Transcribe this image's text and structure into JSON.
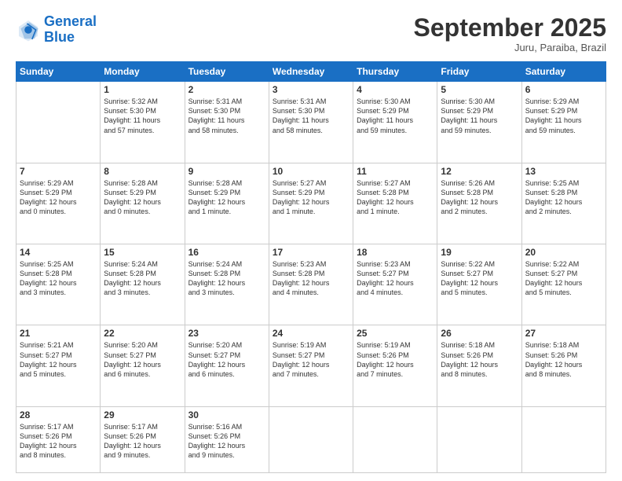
{
  "logo": {
    "line1": "General",
    "line2": "Blue"
  },
  "title": "September 2025",
  "subtitle": "Juru, Paraiba, Brazil",
  "weekdays": [
    "Sunday",
    "Monday",
    "Tuesday",
    "Wednesday",
    "Thursday",
    "Friday",
    "Saturday"
  ],
  "weeks": [
    [
      {
        "day": "",
        "info": ""
      },
      {
        "day": "1",
        "info": "Sunrise: 5:32 AM\nSunset: 5:30 PM\nDaylight: 11 hours\nand 57 minutes."
      },
      {
        "day": "2",
        "info": "Sunrise: 5:31 AM\nSunset: 5:30 PM\nDaylight: 11 hours\nand 58 minutes."
      },
      {
        "day": "3",
        "info": "Sunrise: 5:31 AM\nSunset: 5:30 PM\nDaylight: 11 hours\nand 58 minutes."
      },
      {
        "day": "4",
        "info": "Sunrise: 5:30 AM\nSunset: 5:29 PM\nDaylight: 11 hours\nand 59 minutes."
      },
      {
        "day": "5",
        "info": "Sunrise: 5:30 AM\nSunset: 5:29 PM\nDaylight: 11 hours\nand 59 minutes."
      },
      {
        "day": "6",
        "info": "Sunrise: 5:29 AM\nSunset: 5:29 PM\nDaylight: 11 hours\nand 59 minutes."
      }
    ],
    [
      {
        "day": "7",
        "info": "Sunrise: 5:29 AM\nSunset: 5:29 PM\nDaylight: 12 hours\nand 0 minutes."
      },
      {
        "day": "8",
        "info": "Sunrise: 5:28 AM\nSunset: 5:29 PM\nDaylight: 12 hours\nand 0 minutes."
      },
      {
        "day": "9",
        "info": "Sunrise: 5:28 AM\nSunset: 5:29 PM\nDaylight: 12 hours\nand 1 minute."
      },
      {
        "day": "10",
        "info": "Sunrise: 5:27 AM\nSunset: 5:29 PM\nDaylight: 12 hours\nand 1 minute."
      },
      {
        "day": "11",
        "info": "Sunrise: 5:27 AM\nSunset: 5:28 PM\nDaylight: 12 hours\nand 1 minute."
      },
      {
        "day": "12",
        "info": "Sunrise: 5:26 AM\nSunset: 5:28 PM\nDaylight: 12 hours\nand 2 minutes."
      },
      {
        "day": "13",
        "info": "Sunrise: 5:25 AM\nSunset: 5:28 PM\nDaylight: 12 hours\nand 2 minutes."
      }
    ],
    [
      {
        "day": "14",
        "info": "Sunrise: 5:25 AM\nSunset: 5:28 PM\nDaylight: 12 hours\nand 3 minutes."
      },
      {
        "day": "15",
        "info": "Sunrise: 5:24 AM\nSunset: 5:28 PM\nDaylight: 12 hours\nand 3 minutes."
      },
      {
        "day": "16",
        "info": "Sunrise: 5:24 AM\nSunset: 5:28 PM\nDaylight: 12 hours\nand 3 minutes."
      },
      {
        "day": "17",
        "info": "Sunrise: 5:23 AM\nSunset: 5:28 PM\nDaylight: 12 hours\nand 4 minutes."
      },
      {
        "day": "18",
        "info": "Sunrise: 5:23 AM\nSunset: 5:27 PM\nDaylight: 12 hours\nand 4 minutes."
      },
      {
        "day": "19",
        "info": "Sunrise: 5:22 AM\nSunset: 5:27 PM\nDaylight: 12 hours\nand 5 minutes."
      },
      {
        "day": "20",
        "info": "Sunrise: 5:22 AM\nSunset: 5:27 PM\nDaylight: 12 hours\nand 5 minutes."
      }
    ],
    [
      {
        "day": "21",
        "info": "Sunrise: 5:21 AM\nSunset: 5:27 PM\nDaylight: 12 hours\nand 5 minutes."
      },
      {
        "day": "22",
        "info": "Sunrise: 5:20 AM\nSunset: 5:27 PM\nDaylight: 12 hours\nand 6 minutes."
      },
      {
        "day": "23",
        "info": "Sunrise: 5:20 AM\nSunset: 5:27 PM\nDaylight: 12 hours\nand 6 minutes."
      },
      {
        "day": "24",
        "info": "Sunrise: 5:19 AM\nSunset: 5:27 PM\nDaylight: 12 hours\nand 7 minutes."
      },
      {
        "day": "25",
        "info": "Sunrise: 5:19 AM\nSunset: 5:26 PM\nDaylight: 12 hours\nand 7 minutes."
      },
      {
        "day": "26",
        "info": "Sunrise: 5:18 AM\nSunset: 5:26 PM\nDaylight: 12 hours\nand 8 minutes."
      },
      {
        "day": "27",
        "info": "Sunrise: 5:18 AM\nSunset: 5:26 PM\nDaylight: 12 hours\nand 8 minutes."
      }
    ],
    [
      {
        "day": "28",
        "info": "Sunrise: 5:17 AM\nSunset: 5:26 PM\nDaylight: 12 hours\nand 8 minutes."
      },
      {
        "day": "29",
        "info": "Sunrise: 5:17 AM\nSunset: 5:26 PM\nDaylight: 12 hours\nand 9 minutes."
      },
      {
        "day": "30",
        "info": "Sunrise: 5:16 AM\nSunset: 5:26 PM\nDaylight: 12 hours\nand 9 minutes."
      },
      {
        "day": "",
        "info": ""
      },
      {
        "day": "",
        "info": ""
      },
      {
        "day": "",
        "info": ""
      },
      {
        "day": "",
        "info": ""
      }
    ]
  ]
}
